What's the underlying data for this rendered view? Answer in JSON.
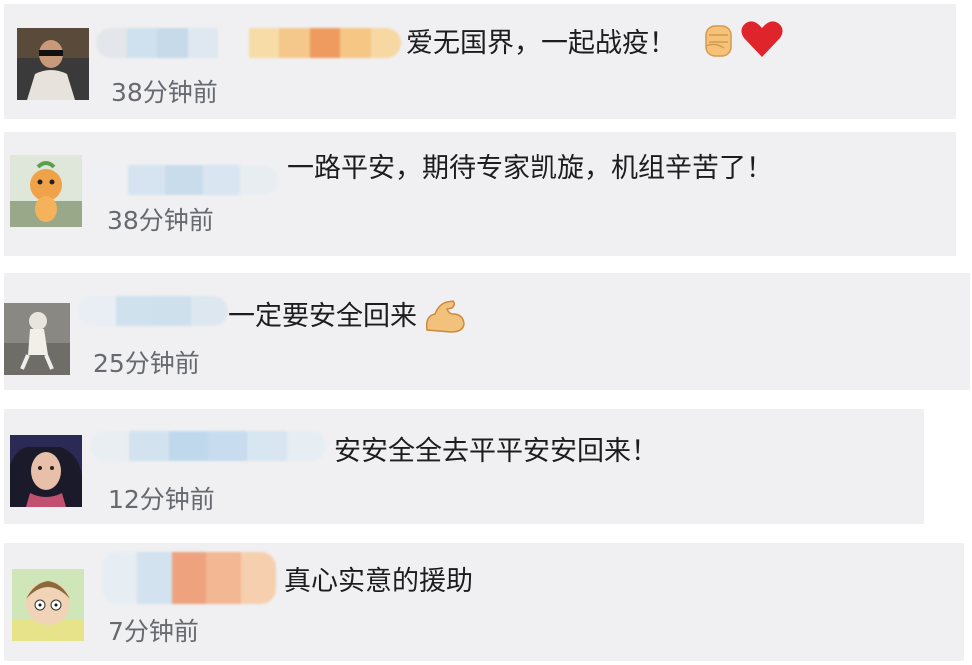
{
  "comments": [
    {
      "text": "爱无国界，一起战疫！",
      "time": "38分钟前",
      "emoji": [
        "raised-fist-icon",
        "red-heart-icon"
      ]
    },
    {
      "text": "一路平安，期待专家凯旋，机组辛苦了！",
      "time": "38分钟前"
    },
    {
      "text": "一定要安全回来",
      "time": "25分钟前",
      "emoji": [
        "flexed-biceps-icon"
      ]
    },
    {
      "text": "安安全全去平平安安回来！",
      "time": "12分钟前"
    },
    {
      "text": "真心实意的援助",
      "time": "7分钟前"
    }
  ],
  "colors": {
    "card_bg": "#f0f0f2",
    "text": "#1d1d1f",
    "time": "#666a70",
    "heart": "#e0242b"
  }
}
